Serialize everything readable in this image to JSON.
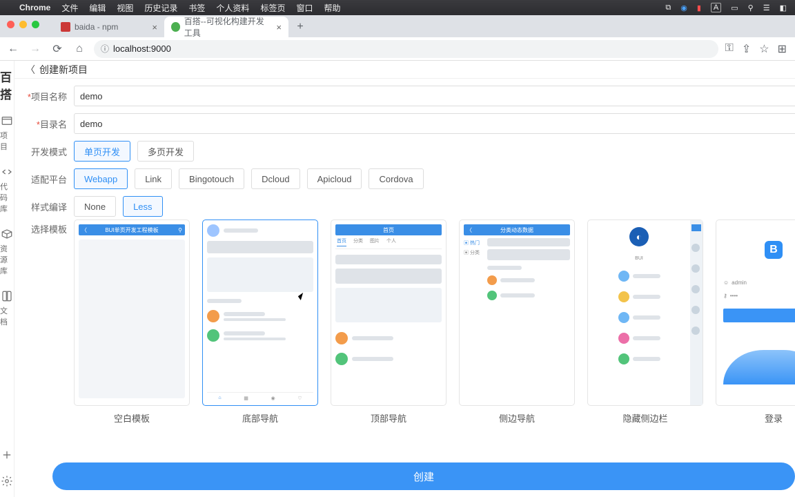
{
  "menubar": {
    "app": "Chrome",
    "items": [
      "文件",
      "编辑",
      "视图",
      "历史记录",
      "书签",
      "个人资料",
      "标签页",
      "窗口",
      "帮助"
    ]
  },
  "tabs": [
    {
      "title": "baida - npm",
      "active": false
    },
    {
      "title": "百搭--可视化构建开发工具",
      "active": true
    }
  ],
  "address": "localhost:9000",
  "brand": "百搭",
  "sidenav": [
    {
      "id": "projects",
      "label": "项目"
    },
    {
      "id": "code",
      "label": "代码库"
    },
    {
      "id": "assets",
      "label": "资源库"
    },
    {
      "id": "docs",
      "label": "文档"
    }
  ],
  "page_title": "创建新项目",
  "form": {
    "name_label": "项目名称",
    "name_value": "demo",
    "dir_label": "目录名",
    "dir_value": "demo",
    "mode_label": "开发模式",
    "modes": [
      "单页开发",
      "多页开发"
    ],
    "mode_selected": "单页开发",
    "platform_label": "适配平台",
    "platforms": [
      "Webapp",
      "Link",
      "Bingotouch",
      "Dcloud",
      "Apicloud",
      "Cordova"
    ],
    "platform_selected": "Webapp",
    "style_label": "样式编译",
    "styles": [
      "None",
      "Less"
    ],
    "style_selected": "Less",
    "template_label": "选择模板"
  },
  "templates": [
    {
      "id": "blank",
      "name": "空白模板",
      "header": "BUI单页开发工程模板"
    },
    {
      "id": "bottom",
      "name": "底部导航",
      "selected": true
    },
    {
      "id": "top",
      "name": "顶部导航",
      "header": "首页",
      "tabs": [
        "首页",
        "分类",
        "图片",
        "个人"
      ]
    },
    {
      "id": "side",
      "name": "侧边导航",
      "header": "分类动态数据",
      "side": [
        "热门",
        "分类"
      ]
    },
    {
      "id": "hidden",
      "name": "隐藏侧边栏",
      "brand": "BUI"
    },
    {
      "id": "login",
      "name": "登录",
      "user": "admin"
    }
  ],
  "create_label": "创建"
}
